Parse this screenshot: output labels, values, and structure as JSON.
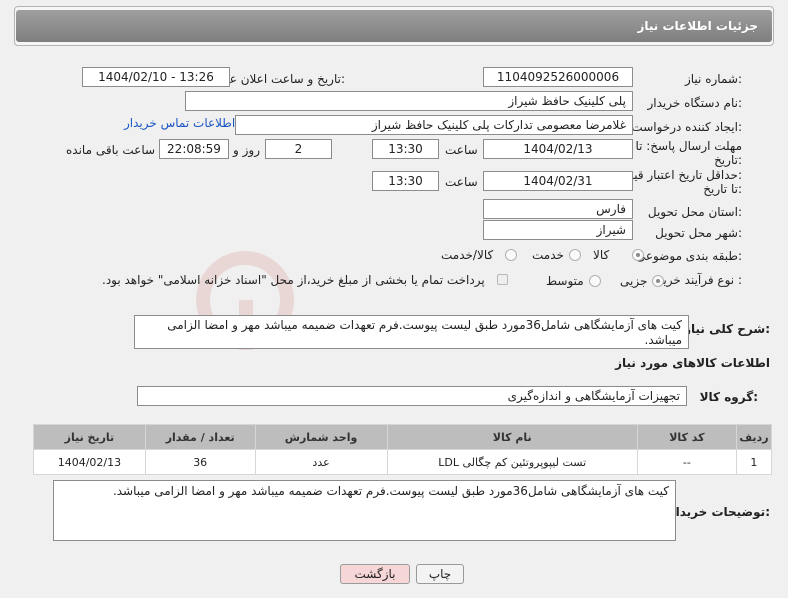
{
  "header": {
    "title": "جزئیات اطلاعات نیاز"
  },
  "fields": {
    "need_number_label": "شماره نیاز:",
    "need_number": "1104092526000006",
    "announce_label": "تاریخ و ساعت اعلان عمومی:",
    "announce_value": "1404/02/10 - 13:26",
    "buyer_org_label": "نام دستگاه خریدار:",
    "buyer_org": "پلی کلینیک حافظ شیراز",
    "creator_label": "ایجاد کننده درخواست:",
    "creator": "غلامرضا معصومی تدارکات پلی کلینیک حافظ شیراز",
    "contact_link": "اطلاعات تماس خریدار",
    "reply_deadline_label_1": "مهلت ارسال پاسخ: تا",
    "reply_deadline_label_2": "تاریخ:",
    "reply_date": "1404/02/13",
    "time_label": "ساعت",
    "reply_time": "13:30",
    "days_value": "2",
    "days_label": "روز و",
    "remaining_time": "22:08:59",
    "remaining_label": "ساعت باقی مانده",
    "price_validity_label_1": "حداقل تاریخ اعتبار قیمت:",
    "price_validity_label_2": "تا تاریخ:",
    "price_date": "1404/02/31",
    "price_time": "13:30",
    "province_label": "استان محل تحویل:",
    "province": "فارس",
    "city_label": "شهر محل تحویل:",
    "city": "شیراز",
    "category_label": "طبقه بندی موضوعی:",
    "category_options": [
      "کالا",
      "خدمت",
      "کالا/خدمت"
    ],
    "process_label": "نوع فرآیند خرید :",
    "process_options": [
      "جزیی",
      "متوسط"
    ],
    "payment_note": "پرداخت تمام یا بخشی از مبلغ خرید،از محل \"اسناد خزانه اسلامی\" خواهد بود."
  },
  "description": {
    "label": "شرح کلی نیاز:",
    "text": "کیت های آزمایشگاهی شامل36مورد طبق لیست پیوست.فرم تعهدات ضمیمه میباشد مهر و امضا الزامی میباشد."
  },
  "goods": {
    "section_title": "اطلاعات کالاهای مورد نیاز",
    "group_label": "گروه کالا:",
    "group_value": "تجهیزات آزمایشگاهی و اندازه‌گیری",
    "columns": [
      "ردیف",
      "کد کالا",
      "نام کالا",
      "واحد شمارش",
      "تعداد / مقدار",
      "تاریخ نیاز"
    ],
    "rows": [
      {
        "row": "1",
        "code": "--",
        "name": "تست لیپوپروتئین کم چگالی LDL",
        "unit": "عدد",
        "qty": "36",
        "date": "1404/02/13"
      }
    ]
  },
  "buyer_notes": {
    "label": "توضیحات خریدار:",
    "text": "کیت های آزمایشگاهی شامل36مورد طبق لیست پیوست.فرم تعهدات ضمیمه میباشد مهر و امضا الزامی میباشد."
  },
  "buttons": {
    "print": "چاپ",
    "back": "بازگشت"
  },
  "watermark_text": "AriaTender.net",
  "colors": {
    "link": "#1a56c4",
    "header": "#8e8e8e",
    "back_button": "#f6d6d6"
  }
}
